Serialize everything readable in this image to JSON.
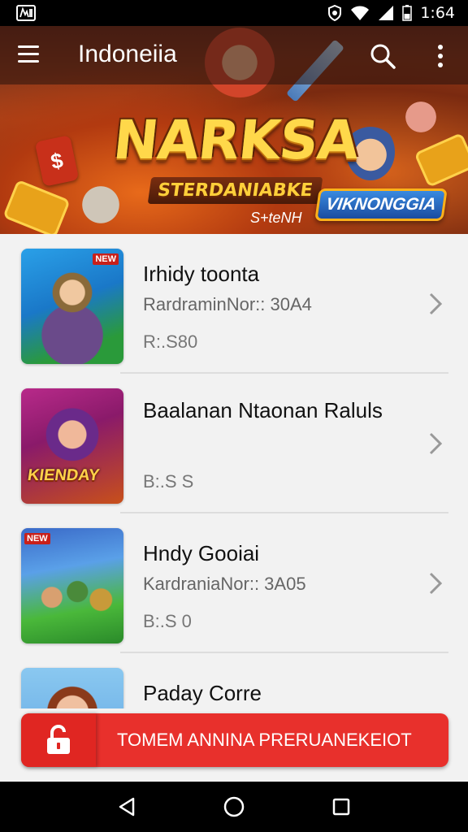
{
  "status_bar": {
    "time": "1:64",
    "icons": [
      "app-notification-icon",
      "shield-icon",
      "wifi-icon",
      "signal-icon",
      "battery-icon"
    ]
  },
  "app_bar": {
    "title": "Indoneiia",
    "icons": [
      "menu-icon",
      "search-icon",
      "more-vert-icon"
    ]
  },
  "hero": {
    "title": "NARKSA",
    "subtitle": "STERDANIABKE",
    "caption": "S+teNH",
    "badge": "VIKNONGGIA",
    "colors": {
      "title": "#ffd84a",
      "badge": "#2a6ac8",
      "badge_border": "#ffb21a"
    }
  },
  "items": [
    {
      "title": "Irhidy toonta",
      "subtitle": "RardraminNor:: 30A4",
      "price": "R:.S80",
      "thumb_icon": "warrior-game-icon"
    },
    {
      "title": "Baalanan Ntaonan Raluls",
      "subtitle": "",
      "price": "B:.S S",
      "thumb_icon": "hero-game-icon",
      "thumb_text": "KIENDAY"
    },
    {
      "title": "Hndy Gooiai",
      "subtitle": "KardraniaNor:: 3A05",
      "price": "B:.S 0",
      "thumb_icon": "battle-game-icon"
    },
    {
      "title": "Paday Corre",
      "subtitle": "",
      "price": "",
      "thumb_icon": "adventure-game-icon"
    }
  ],
  "cta": {
    "label": "TOMEM ANNINA PRERUANEKEIOT",
    "icon": "unlock-icon",
    "color": "#e8302c"
  },
  "nav_bar": {
    "icons": [
      "back-icon",
      "home-icon",
      "recents-icon"
    ]
  }
}
